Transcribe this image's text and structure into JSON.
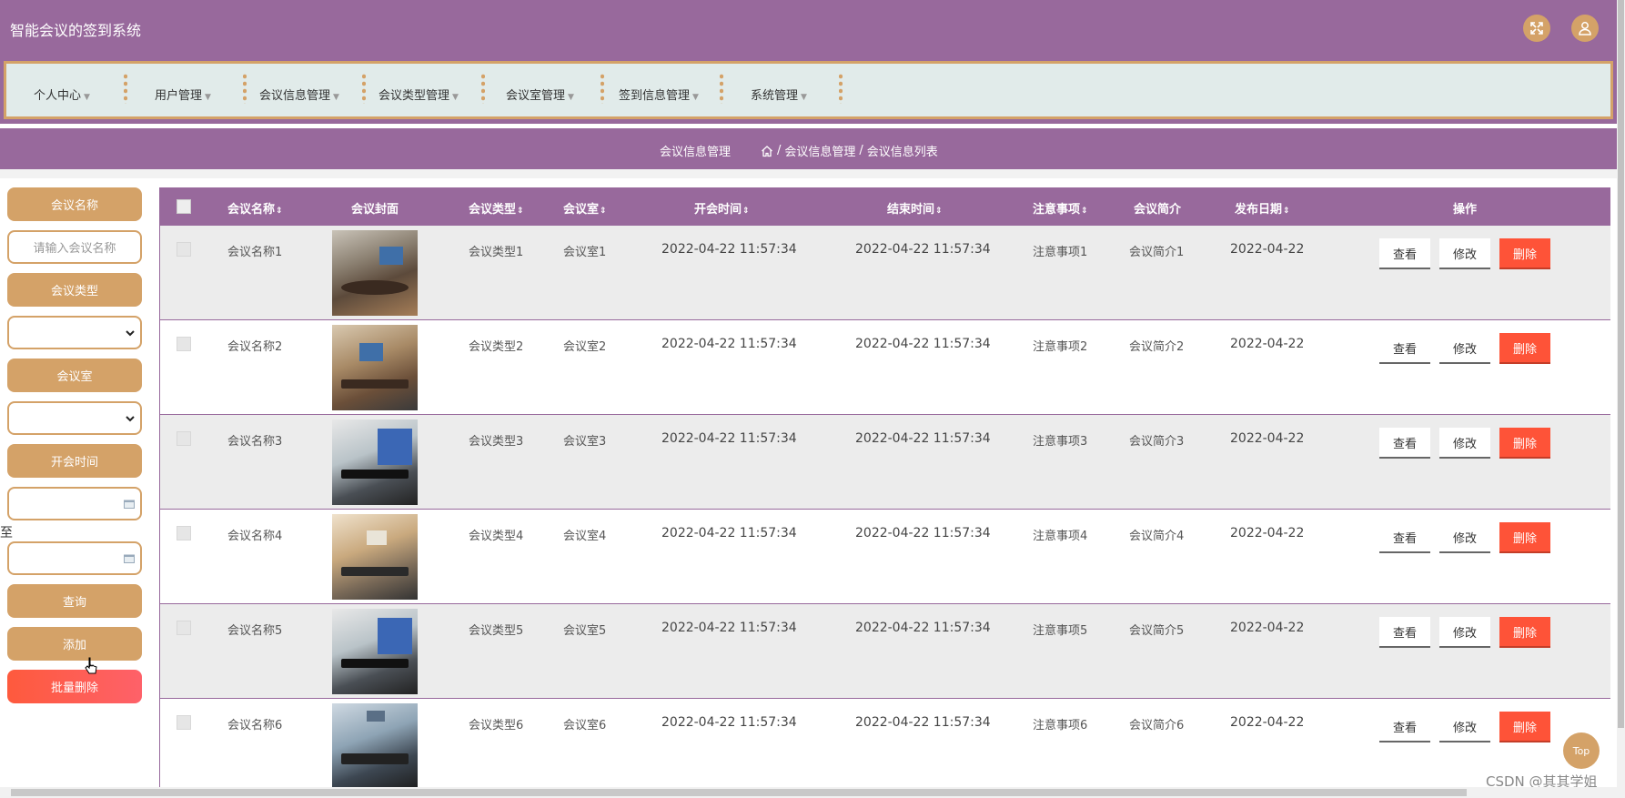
{
  "header": {
    "title": "智能会议的签到系统",
    "fullscreen_icon": "fullscreen-icon",
    "user_icon": "user-icon"
  },
  "nav": {
    "items": [
      {
        "label": "个人中心"
      },
      {
        "label": "用户管理"
      },
      {
        "label": "会议信息管理"
      },
      {
        "label": "会议类型管理"
      },
      {
        "label": "会议室管理"
      },
      {
        "label": "签到信息管理"
      },
      {
        "label": "系统管理"
      }
    ]
  },
  "breadcrumb": {
    "title": "会议信息管理",
    "path": [
      "会议信息管理",
      "会议信息列表"
    ],
    "separator": "/"
  },
  "search": {
    "name_label": "会议名称",
    "name_placeholder": "请输入会议名称",
    "type_label": "会议类型",
    "type_value": "",
    "room_label": "会议室",
    "room_value": "",
    "time_label": "开会时间",
    "to_label": "至",
    "query_button": "查询",
    "add_button": "添加",
    "batch_delete_button": "批量删除"
  },
  "table": {
    "headers": {
      "name": "会议名称",
      "cover": "会议封面",
      "type": "会议类型",
      "room": "会议室",
      "start": "开会时间",
      "end": "结束时间",
      "notes": "注意事项",
      "intro": "会议简介",
      "published": "发布日期",
      "actions": "操作"
    },
    "action_labels": {
      "view": "查看",
      "edit": "修改",
      "delete": "删除"
    },
    "rows": [
      {
        "name": "会议名称1",
        "type": "会议类型1",
        "room": "会议室1",
        "start": "2022-04-22 11:57:34",
        "end": "2022-04-22 11:57:34",
        "notes": "注意事项1",
        "intro": "会议简介1",
        "published": "2022-04-22"
      },
      {
        "name": "会议名称2",
        "type": "会议类型2",
        "room": "会议室2",
        "start": "2022-04-22 11:57:34",
        "end": "2022-04-22 11:57:34",
        "notes": "注意事项2",
        "intro": "会议简介2",
        "published": "2022-04-22"
      },
      {
        "name": "会议名称3",
        "type": "会议类型3",
        "room": "会议室3",
        "start": "2022-04-22 11:57:34",
        "end": "2022-04-22 11:57:34",
        "notes": "注意事项3",
        "intro": "会议简介3",
        "published": "2022-04-22"
      },
      {
        "name": "会议名称4",
        "type": "会议类型4",
        "room": "会议室4",
        "start": "2022-04-22 11:57:34",
        "end": "2022-04-22 11:57:34",
        "notes": "注意事项4",
        "intro": "会议简介4",
        "published": "2022-04-22"
      },
      {
        "name": "会议名称5",
        "type": "会议类型5",
        "room": "会议室5",
        "start": "2022-04-22 11:57:34",
        "end": "2022-04-22 11:57:34",
        "notes": "注意事项5",
        "intro": "会议简介5",
        "published": "2022-04-22"
      },
      {
        "name": "会议名称6",
        "type": "会议类型6",
        "room": "会议室6",
        "start": "2022-04-22 11:57:34",
        "end": "2022-04-22 11:57:34",
        "notes": "注意事项6",
        "intro": "会议简介6",
        "published": "2022-04-22"
      }
    ]
  },
  "top_button": "Top",
  "watermark": "CSDN @其其学姐",
  "colors": {
    "primary": "#98699c",
    "accent": "#d4a268",
    "danger": "#fe5338",
    "nav_bg": "#e1ebea"
  }
}
